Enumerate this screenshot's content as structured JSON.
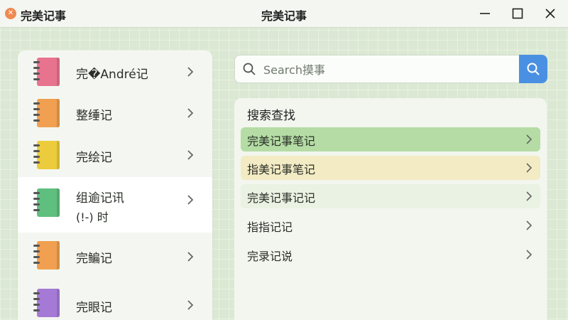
{
  "window": {
    "app_icon": "close-badge-icon",
    "app_name": "完美记事",
    "title": "完美记事",
    "controls": [
      "minimize-icon",
      "maximize-icon",
      "close-icon"
    ]
  },
  "notebooks": [
    {
      "label": "完�André记",
      "color": "#e8738f"
    },
    {
      "label": "整缍记",
      "color": "#f0a050"
    },
    {
      "label": "完绘记",
      "color": "#eccc3c"
    },
    {
      "label": "组逾记讯",
      "sublabel": "(!-) 时",
      "color": "#5fbf7f",
      "selected": true
    },
    {
      "label": "完鳊记",
      "color": "#f0a050"
    },
    {
      "label": "完眼记",
      "color": "#a57ad6"
    }
  ],
  "search": {
    "placeholder": "Search摸事",
    "value": "",
    "button_icon": "search-icon"
  },
  "results": {
    "heading": "搜索查找",
    "items": [
      {
        "label": "完美记事笔记",
        "color": "#b4dca4"
      },
      {
        "label": "指美记事笔记",
        "color": "#f3ebc4"
      },
      {
        "label": "完美记事记记",
        "color": "#eaf2e3"
      },
      {
        "label": "指指记记",
        "color": ""
      },
      {
        "label": "完录记说",
        "color": ""
      }
    ]
  }
}
